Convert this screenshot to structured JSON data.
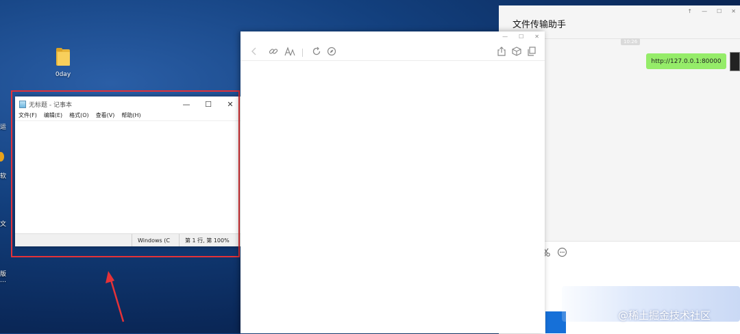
{
  "desktop": {
    "icon_label": "0day",
    "left_fragments": [
      "运",
      "软",
      "文",
      "版",
      "…"
    ]
  },
  "notepad": {
    "title": "无标题 - 记事本",
    "controls": [
      "—",
      "☐",
      "✕"
    ],
    "menu": [
      "文件(F)",
      "编辑(E)",
      "格式(O)",
      "查看(V)",
      "帮助(H)"
    ],
    "status_encoding": "Windows (C",
    "status_position": "第 1 行, 第",
    "status_zoom": "100%"
  },
  "browser": {
    "controls": [
      "—",
      "☐",
      "✕"
    ],
    "icons": [
      "back-icon",
      "link-icon",
      "font-size-icon",
      "refresh-icon",
      "compass-icon",
      "share-icon",
      "cube-icon",
      "copy-icon"
    ]
  },
  "wechat": {
    "title": "文件传输助手",
    "controls": [
      "↑",
      "—",
      "☐",
      "✕"
    ],
    "timestamp": "10:26",
    "message": "http://127.0.0.1:80000"
  },
  "watermark": "@稀土掘金技术社区",
  "colors": {
    "highlight": "#e53238",
    "bubble": "#95ec69",
    "desktop": "#0a2757"
  }
}
